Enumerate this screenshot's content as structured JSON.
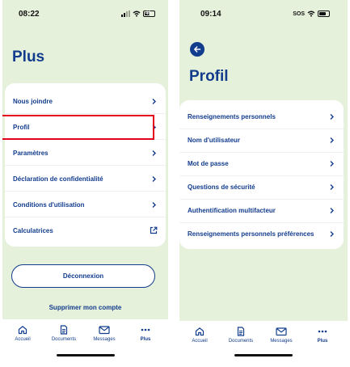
{
  "left_screen": {
    "status": {
      "time": "08:22",
      "battery": "40"
    },
    "title": "Plus",
    "menu": [
      {
        "label": "Nous joindre",
        "icon": "chevron-right-icon"
      },
      {
        "label": "Profil",
        "icon": "chevron-right-icon",
        "highlighted": true
      },
      {
        "label": "Paramètres",
        "icon": "chevron-right-icon"
      },
      {
        "label": "Déclaration de confidentialité",
        "icon": "chevron-right-icon"
      },
      {
        "label": "Conditions d'utilisation",
        "icon": "chevron-right-icon"
      },
      {
        "label": "Calculatrices",
        "icon": "external-link-icon"
      }
    ],
    "logout_label": "Déconnexion",
    "delete_label": "Supprimer mon compte",
    "highlight_color": "#e3001b"
  },
  "right_screen": {
    "status": {
      "time": "09:14",
      "carrier": "SOS"
    },
    "title": "Profil",
    "menu": [
      {
        "label": "Renseignements personnels"
      },
      {
        "label": "Nom d'utilisateur"
      },
      {
        "label": "Mot de passe"
      },
      {
        "label": "Questions de sécurité"
      },
      {
        "label": "Authentification multifacteur"
      },
      {
        "label": "Renseignements personnels préférences"
      }
    ]
  },
  "tabbar": {
    "items": [
      {
        "label": "Accueil",
        "icon": "home-icon"
      },
      {
        "label": "Documents",
        "icon": "document-icon"
      },
      {
        "label": "Messages",
        "icon": "mail-icon"
      },
      {
        "label": "Plus",
        "icon": "more-dots-icon",
        "active": true
      }
    ]
  },
  "colors": {
    "brand": "#123c8c",
    "background": "#e6f1dc",
    "highlight": "#e3001b"
  }
}
